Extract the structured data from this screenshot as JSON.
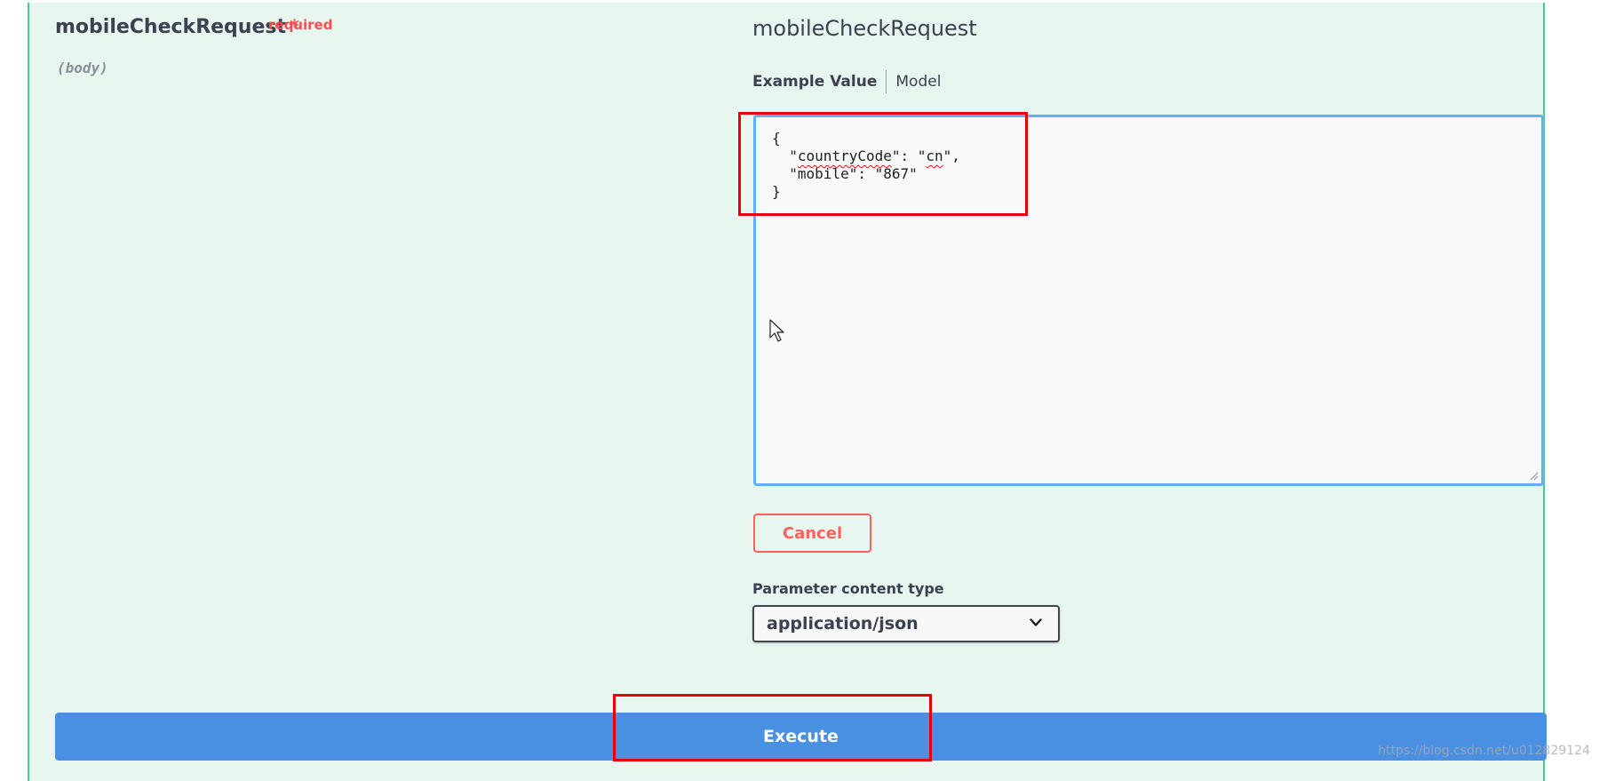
{
  "parameter": {
    "name": "mobileCheckRequest",
    "required_marker": "*",
    "required_label": "required",
    "location": "(body)"
  },
  "schema": {
    "title": "mobileCheckRequest",
    "tabs": {
      "example_value": "Example Value",
      "model": "Model"
    }
  },
  "editor": {
    "lines": [
      "{",
      "  \"countryCode\": \"cn\",",
      "  \"mobile\": \"867\"",
      "}"
    ],
    "spellcheck_flagged": [
      "countryCode",
      "cn"
    ]
  },
  "actions": {
    "cancel_label": "Cancel",
    "execute_label": "Execute"
  },
  "content_type": {
    "label": "Parameter content type",
    "selected": "application/json"
  },
  "watermark": "https://blog.csdn.net/u012829124",
  "colors": {
    "panel_bg": "#e8f6f0",
    "editor_border": "#61affe",
    "cancel": "#ff6060",
    "execute": "#4990e2",
    "annotation": "#e8000b"
  }
}
